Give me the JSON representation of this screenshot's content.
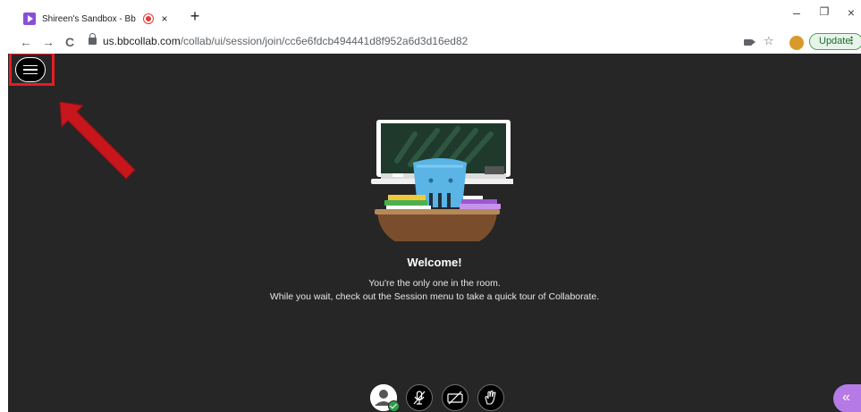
{
  "browser": {
    "tab": {
      "title": "Shireen's Sandbox - Bb Colla",
      "close": "×"
    },
    "new_tab": "+",
    "window_controls": {
      "minimize": "–",
      "maximize": "❐",
      "close": "×"
    },
    "nav": {
      "back": "←",
      "forward": "→",
      "reload": "C"
    },
    "url_host": "us.bbcollab.com",
    "url_path": "/collab/ui/session/join/cc6e6fdcb494441d8f952a6d3d16ed82",
    "star": "☆",
    "update_label": "Update",
    "update_menu": "⋮"
  },
  "app": {
    "welcome_title": "Welcome!",
    "welcome_line1": "You're the only one in the room.",
    "welcome_line2": "While you wait, check out the Session menu to take a quick tour of Collaborate.",
    "panel_toggle": "«"
  },
  "colors": {
    "app_background": "#262626",
    "highlight": "#e51c23",
    "accent_purple": "#b57ae6",
    "status_green": "#2e9d4b"
  },
  "icons": {
    "menu": "hamburger-menu-icon",
    "mic": "microphone-muted-icon",
    "camera": "camera-off-icon",
    "hand": "raise-hand-icon",
    "avatar": "user-avatar-icon"
  }
}
